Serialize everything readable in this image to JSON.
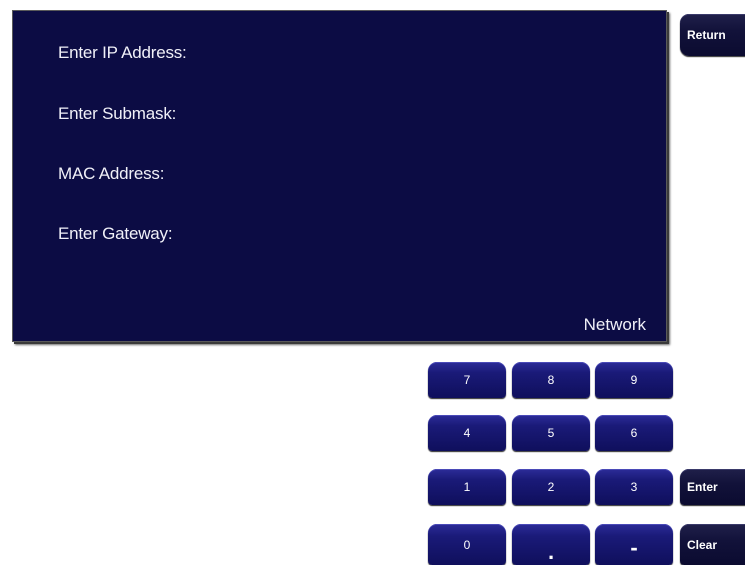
{
  "panel": {
    "title": "Network",
    "fields": [
      {
        "label": "Enter IP Address:"
      },
      {
        "label": "Enter Submask:"
      },
      {
        "label": "MAC Address:"
      },
      {
        "label": "Enter Gateway:"
      }
    ]
  },
  "keypad": {
    "keys": [
      "7",
      "8",
      "9",
      "4",
      "5",
      "6",
      "1",
      "2",
      "3",
      "0",
      ".",
      "-"
    ]
  },
  "actions": {
    "return_label": "Return",
    "enter_label": "Enter",
    "clear_label": "Clear"
  },
  "colors": {
    "panel_background": "#0c0c44",
    "key_background": "#1a1a78",
    "side_key_background": "#12123a",
    "text": "#ffffff"
  }
}
